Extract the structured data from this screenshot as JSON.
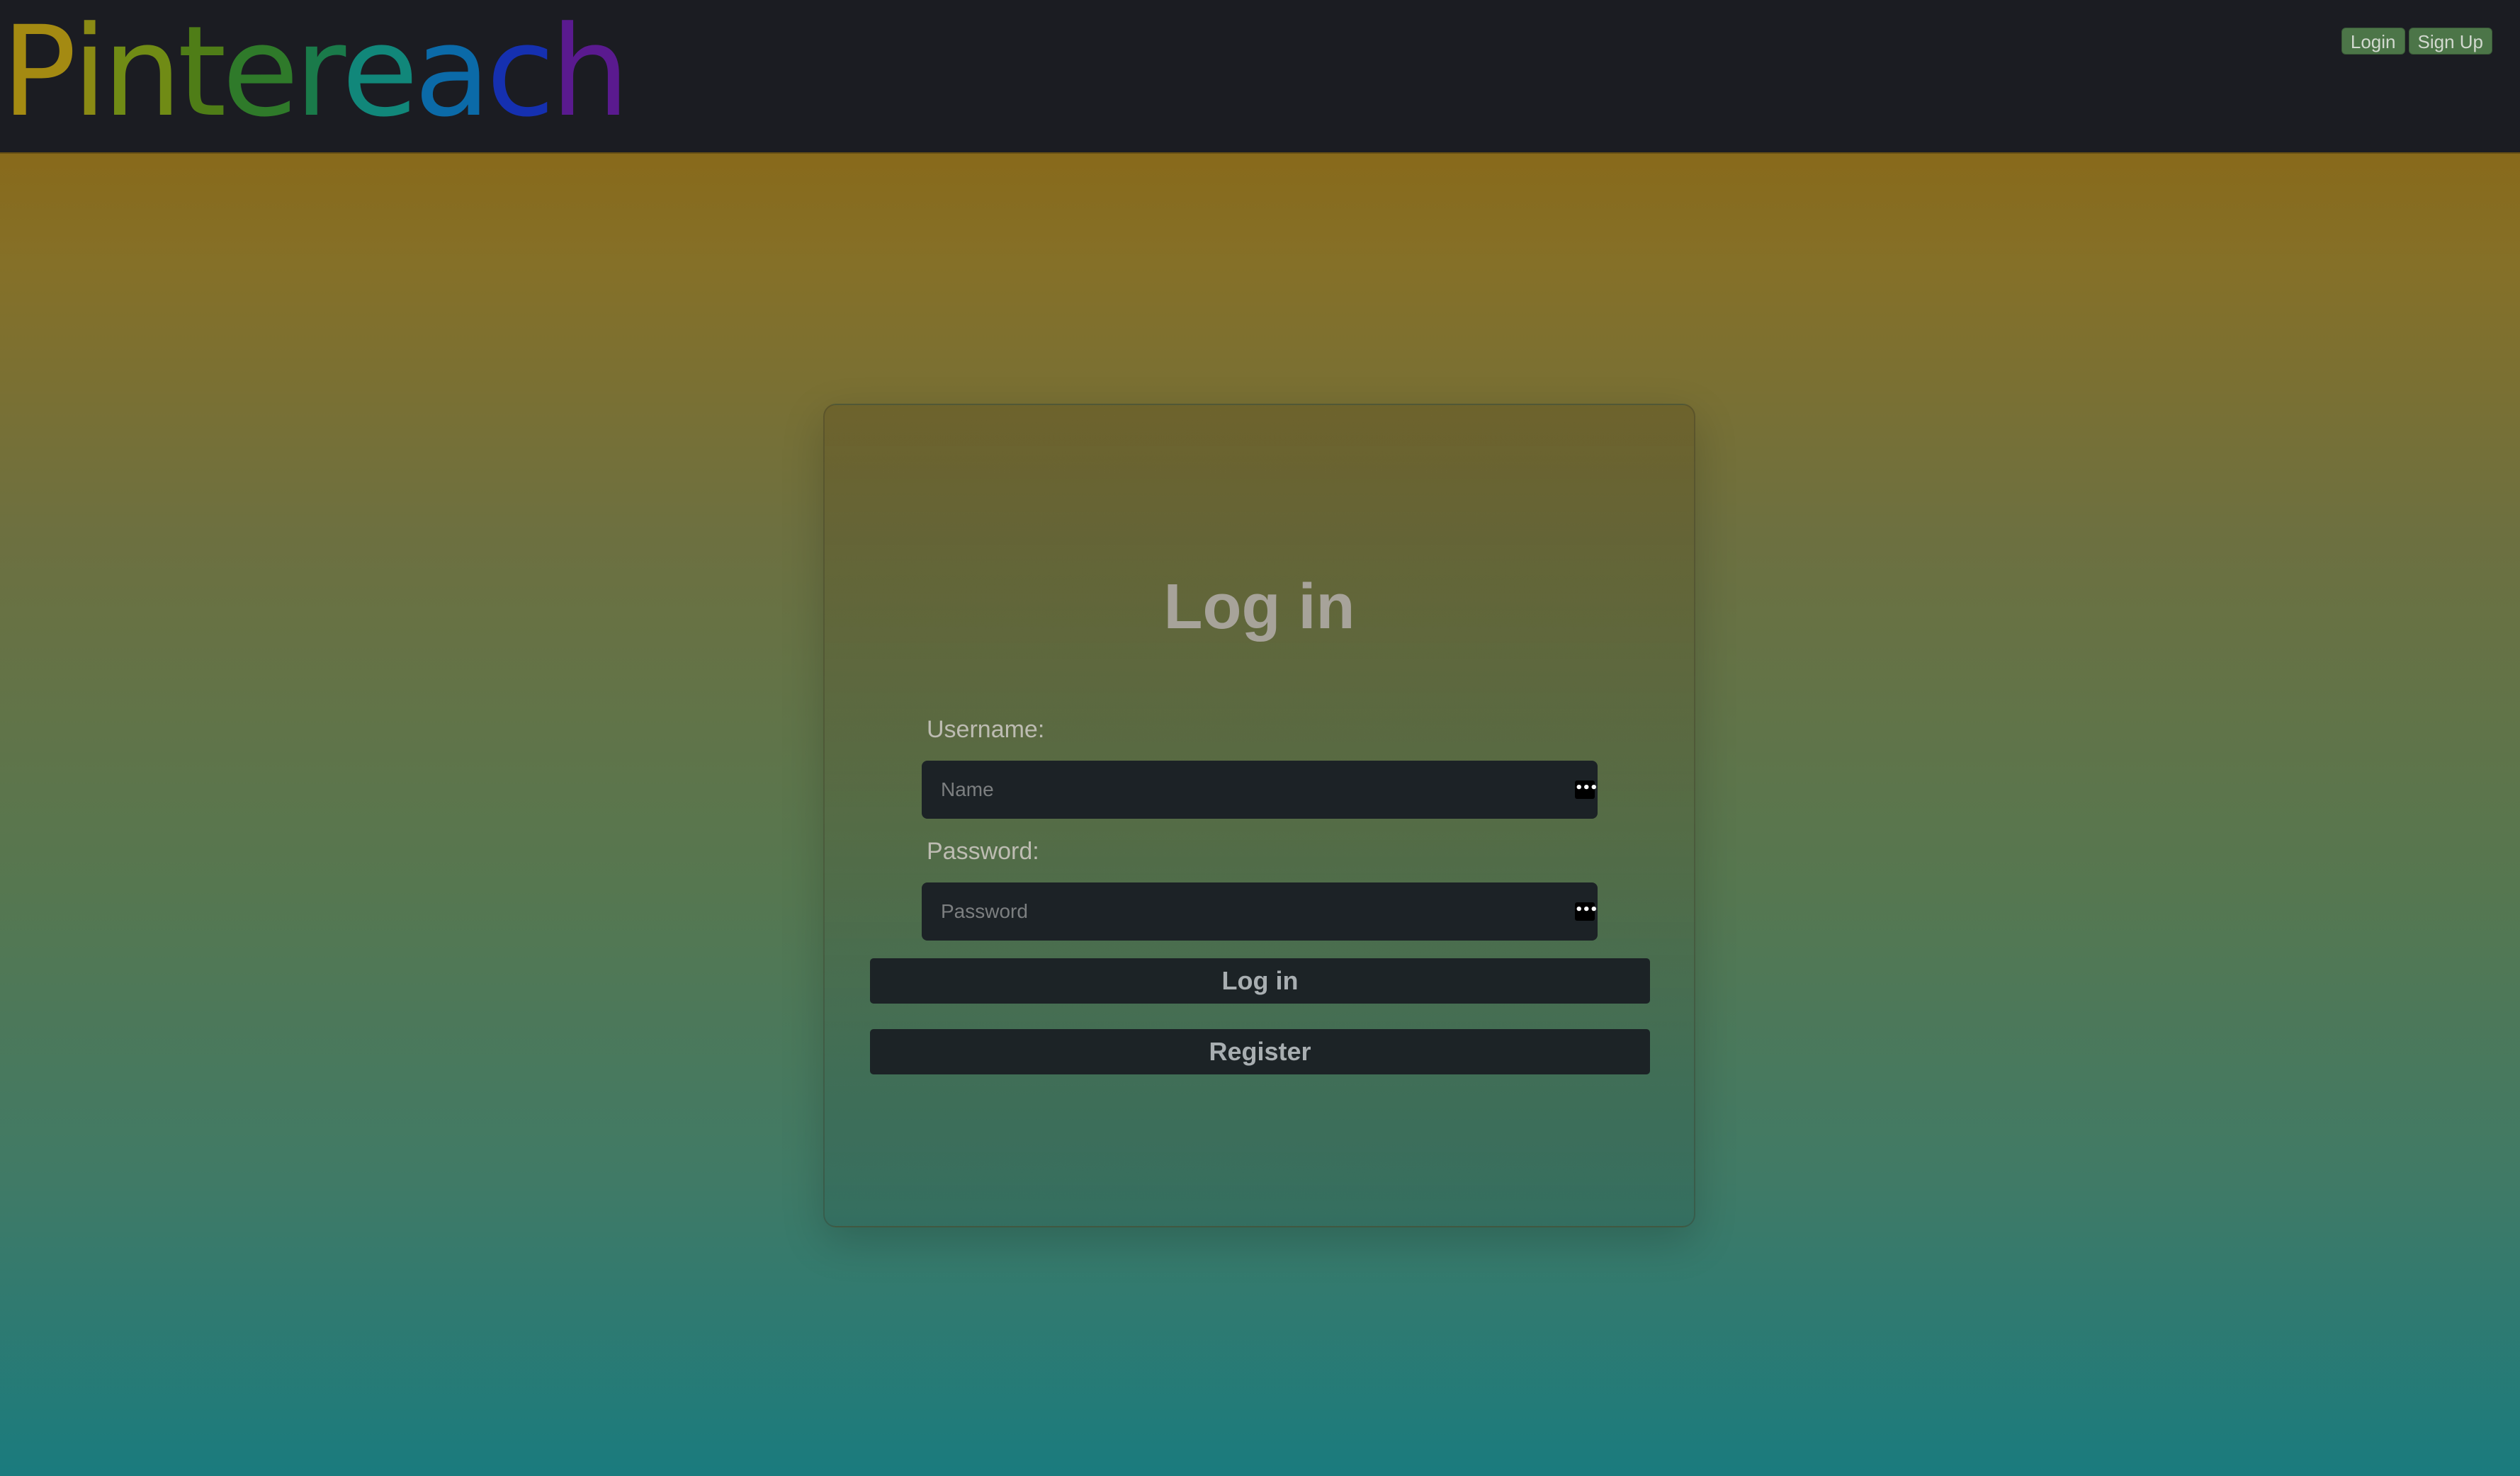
{
  "header": {
    "logo": {
      "letters": [
        {
          "char": "P",
          "color": "#a48a12"
        },
        {
          "char": "i",
          "color": "#8a8a14"
        },
        {
          "char": "n",
          "color": "#708b15"
        },
        {
          "char": "t",
          "color": "#4f7d17"
        },
        {
          "char": "e",
          "color": "#2f7a2a"
        },
        {
          "char": "r",
          "color": "#1a7a4a"
        },
        {
          "char": "e",
          "color": "#11877a"
        },
        {
          "char": "a",
          "color": "#0b6aa8"
        },
        {
          "char": "c",
          "color": "#1530b0"
        },
        {
          "char": "h",
          "color": "#5a1a8f"
        }
      ]
    },
    "nav": {
      "login_label": "Login",
      "signup_label": "Sign Up"
    }
  },
  "login_form": {
    "title": "Log in",
    "username": {
      "label": "Username:",
      "placeholder": "Name",
      "value": ""
    },
    "password": {
      "label": "Password:",
      "placeholder": "Password",
      "value": ""
    },
    "password_manager_icon": "•••",
    "submit_label": "Log in",
    "register_label": "Register"
  },
  "colors": {
    "topbar": "#1b1c22",
    "nav_button": "#4c7548",
    "field_bg": "#1c2226",
    "button_bg": "#1c2326",
    "gradient_top": "#8c6109",
    "gradient_bottom": "#1a7b7e"
  }
}
